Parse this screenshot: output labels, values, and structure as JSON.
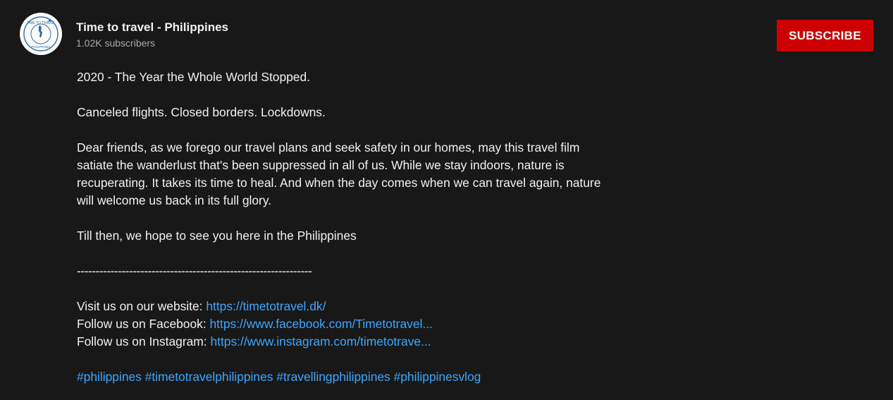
{
  "channel": {
    "name": "Time to travel - Philippines",
    "subscribers": "1.02K subscribers",
    "avatar_text_top": "TIME TO TRAVEL",
    "avatar_text_bottom": "PHILIPPINES"
  },
  "subscribe": {
    "label": "SUBSCRIBE",
    "color": "#cc0000"
  },
  "description": {
    "headline": "2020 - The Year the Whole World Stopped.",
    "line2": "Canceled flights. Closed borders. Lockdowns.",
    "paragraph": [
      "Dear friends, as we forego our travel plans and seek safety in our homes, may this travel film",
      "satiate the wanderlust that's been suppressed in all of us. While we stay indoors, nature is",
      "recuperating. It takes its time to heal. And when the day comes when we can travel again, nature",
      "will welcome us back in its full glory."
    ],
    "closing": "Till then, we hope to see you here in the Philippines",
    "divider": "---------------------------------------------------------------",
    "links": [
      {
        "label": "Visit us on our website: ",
        "url": "https://timetotravel.dk/"
      },
      {
        "label": "Follow us on Facebook: ",
        "url": "https://www.facebook.com/Timetotravel..."
      },
      {
        "label": "Follow us on Instagram: ",
        "url": "https://www.instagram.com/timetotrave..."
      }
    ],
    "hashtags": [
      "#philippines",
      "#timetotravelphilippines",
      "#travellingphilippines",
      "#philippinesvlog"
    ]
  },
  "colors": {
    "background": "#181818",
    "text": "#f1f1f1",
    "secondary_text": "#aaaaaa",
    "link": "#3ea6ff"
  },
  "icons": {
    "avatar": "channel-logo-globe-icon"
  }
}
